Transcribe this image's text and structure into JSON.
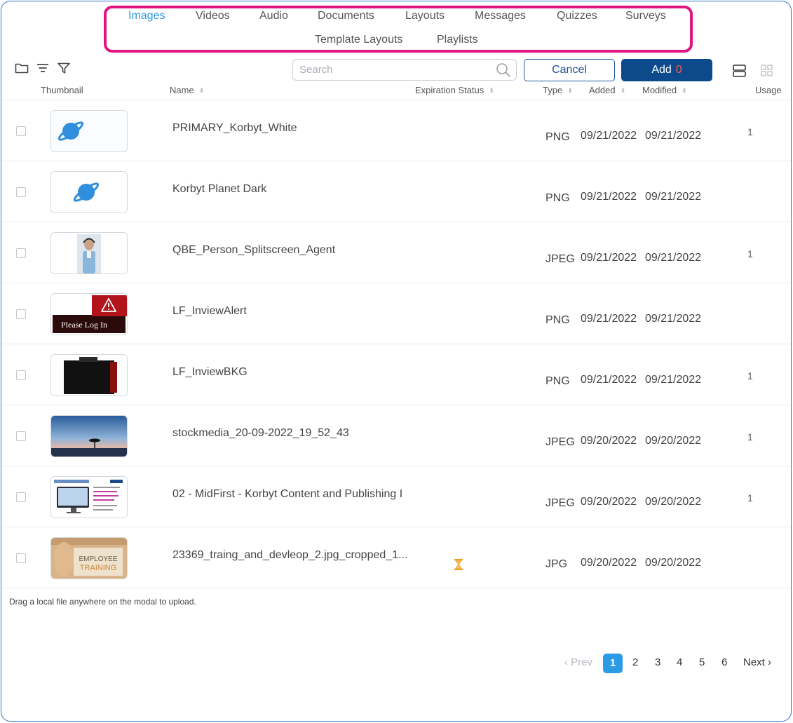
{
  "tabs": [
    {
      "label": "Images",
      "active": true
    },
    {
      "label": "Videos",
      "active": false
    },
    {
      "label": "Audio",
      "active": false
    },
    {
      "label": "Documents",
      "active": false
    },
    {
      "label": "Layouts",
      "active": false
    },
    {
      "label": "Messages",
      "active": false
    },
    {
      "label": "Quizzes",
      "active": false
    },
    {
      "label": "Surveys",
      "active": false
    },
    {
      "label": "Template Layouts",
      "active": false
    },
    {
      "label": "Playlists",
      "active": false
    }
  ],
  "toolbar": {
    "icons": [
      "folder-icon",
      "sort-lines-icon",
      "filter-icon"
    ],
    "search_placeholder": "Search",
    "cancel_label": "Cancel",
    "add_label": "Add",
    "add_count": "0",
    "view_icons": [
      "list-view-icon",
      "grid-view-icon"
    ]
  },
  "columns": {
    "thumbnail": "Thumbnail",
    "name": "Name",
    "expiration": "Expiration Status",
    "type": "Type",
    "added": "Added",
    "modified": "Modified",
    "usage": "Usage"
  },
  "rows": [
    {
      "name": "PRIMARY_Korbyt_White",
      "type": "PNG",
      "added": "09/21/2022",
      "modified": "09/21/2022",
      "usage": "1",
      "thumb": "planet-light"
    },
    {
      "name": "Korbyt Planet Dark",
      "type": "PNG",
      "added": "09/21/2022",
      "modified": "09/21/2022",
      "usage": "",
      "thumb": "planet-dark"
    },
    {
      "name": "QBE_Person_Splitscreen_Agent",
      "type": "JPEG",
      "added": "09/21/2022",
      "modified": "09/21/2022",
      "usage": "1",
      "thumb": "person-headset"
    },
    {
      "name": "LF_InviewAlert",
      "type": "PNG",
      "added": "09/21/2022",
      "modified": "09/21/2022",
      "usage": "",
      "thumb": "alert",
      "thumb_text": "Please Log In"
    },
    {
      "name": "LF_InviewBKG",
      "type": "PNG",
      "added": "09/21/2022",
      "modified": "09/21/2022",
      "usage": "1",
      "thumb": "black-bkg"
    },
    {
      "name": "stockmedia_20-09-2022_19_52_43",
      "type": "JPEG",
      "added": "09/20/2022",
      "modified": "09/20/2022",
      "usage": "1",
      "thumb": "sunset-tree"
    },
    {
      "name": "02 - MidFirst - Korbyt Content and Publishing I",
      "type": "JPEG",
      "added": "09/20/2022",
      "modified": "09/20/2022",
      "usage": "1",
      "thumb": "slide-monitor"
    },
    {
      "name": "23369_traing_and_devleop_2.jpg_cropped_1...",
      "type": "JPG",
      "added": "09/20/2022",
      "modified": "09/20/2022",
      "usage": "",
      "thumb": "employee-training",
      "thumb_text": [
        "EMPLOYEE",
        "TRAINING"
      ],
      "expiring": true
    }
  ],
  "footer": {
    "drag_hint": "Drag a local file anywhere on the modal to upload."
  },
  "pagination": {
    "prev": "‹ Prev",
    "pages": [
      "1",
      "2",
      "3",
      "4",
      "5",
      "6"
    ],
    "current": "1",
    "next": "Next ›"
  },
  "colors": {
    "accent": "#2b9be6",
    "primary_button": "#0d4a8c",
    "highlight_border": "#e0157f",
    "add_count": "#ff5a4f",
    "expiring_icon": "#f0a020"
  }
}
